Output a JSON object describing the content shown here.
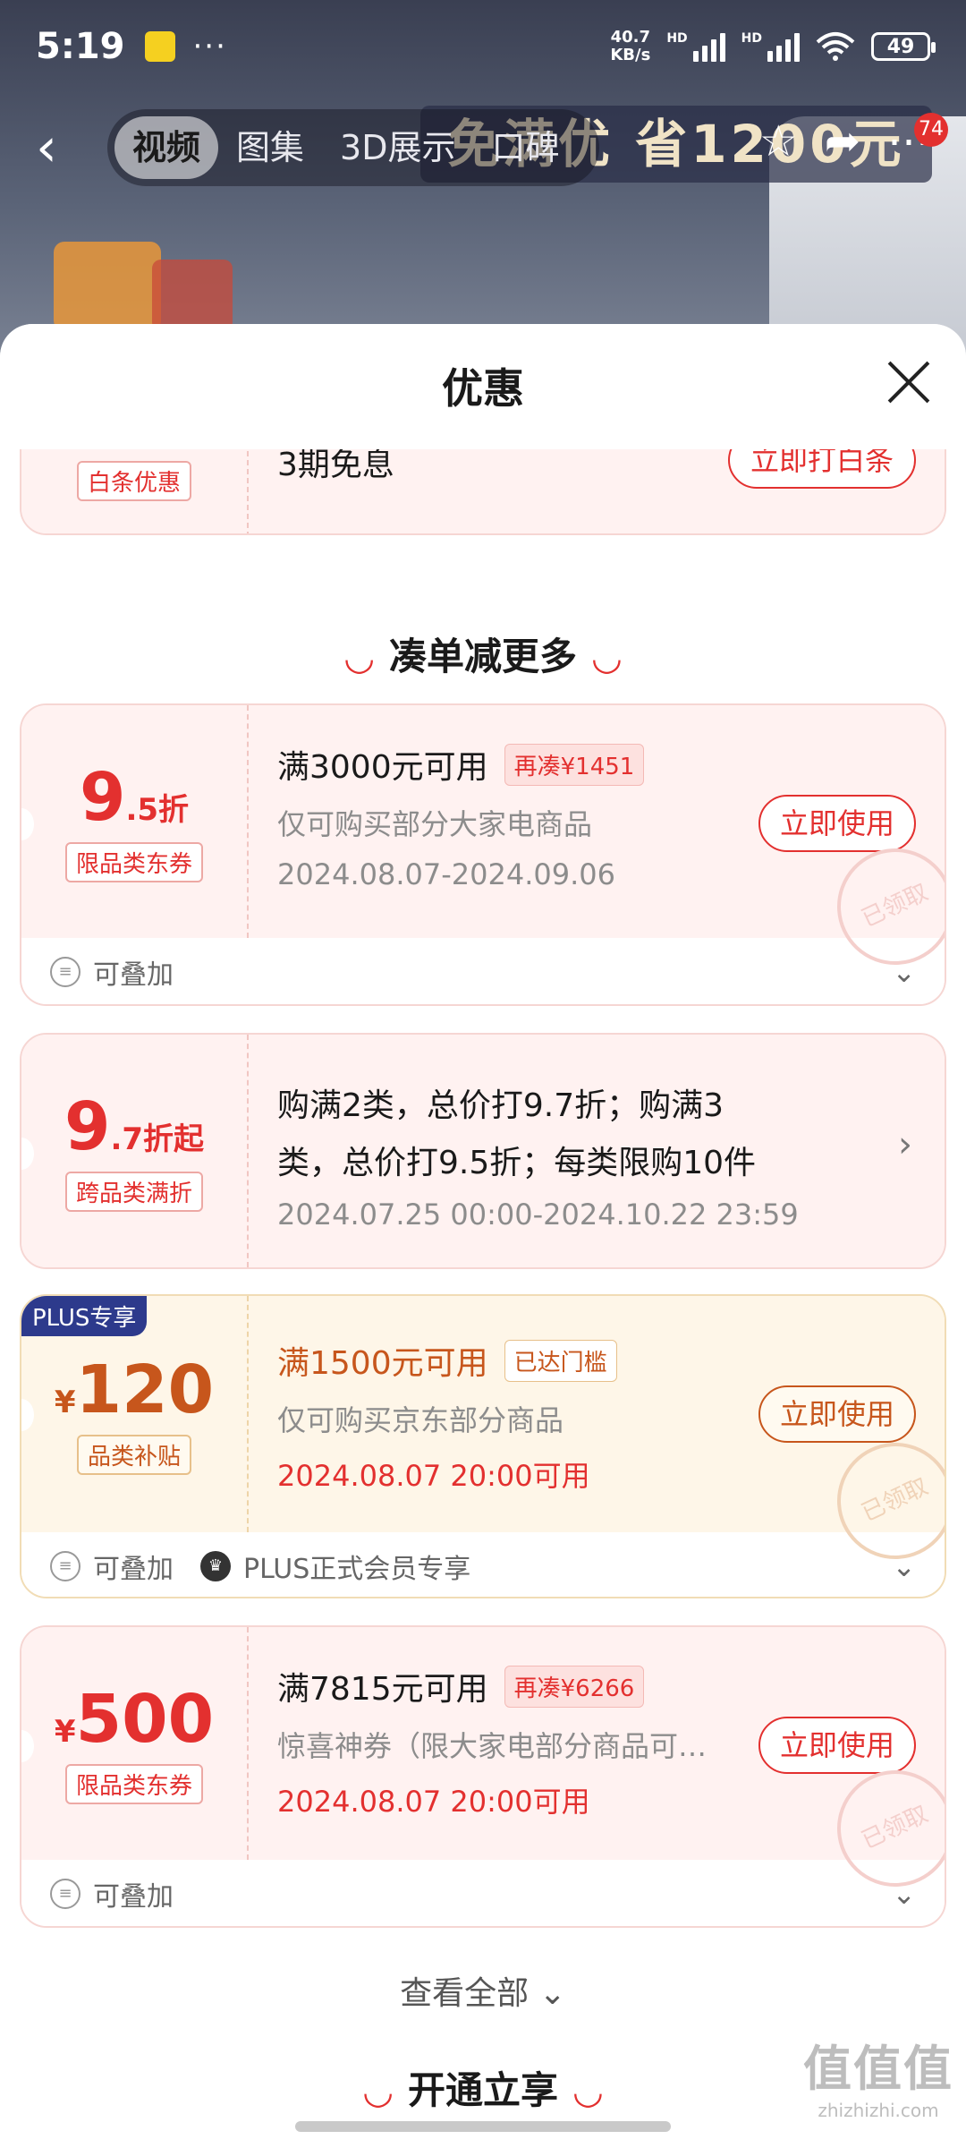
{
  "status_bar": {
    "time": "5:19",
    "dots": "···",
    "net_speed_value": "40.7",
    "net_speed_unit": "KB/s",
    "hd": "HD",
    "battery": "49"
  },
  "nav": {
    "tabs": [
      {
        "label": "视频",
        "active": true
      },
      {
        "label": "图集",
        "active": false
      },
      {
        "label": "3D展示",
        "active": false
      },
      {
        "label": "口碑",
        "active": false
      }
    ],
    "badge_count": "74",
    "banner_text": "免满优 省1200元"
  },
  "sheet": {
    "title": "优惠",
    "baitiao": {
      "tag": "白条优惠",
      "desc": "3期免息",
      "button": "立即打白条"
    },
    "section1": "凑单减更多",
    "coupons": [
      {
        "amount": "9",
        "amount_suffix": ".5折",
        "tag": "限品类东券",
        "condition": "满3000元可用",
        "mini_tag": "再凑¥1451",
        "scope": "仅可购买部分大家电商品",
        "date": "2024.08.07-2024.09.06",
        "button": "立即使用",
        "stamp": "已领取",
        "foot_stack": "可叠加"
      },
      {
        "amount": "9",
        "amount_suffix": ".7折起",
        "tag": "跨品类满折",
        "desc_line1": "购满2类，总价打9.7折；购满3",
        "desc_line2": "类，总价打9.5折；每类限购10件",
        "date": "2024.07.25 00:00-2024.10.22 23:59"
      },
      {
        "plus_badge": "PLUS专享",
        "currency": "¥",
        "amount": "120",
        "tag": "品类补贴",
        "condition": "满1500元可用",
        "mini_tag": "已达门槛",
        "scope": "仅可购买京东部分商品",
        "date": "2024.08.07 20:00可用",
        "button": "立即使用",
        "stamp": "已领取",
        "foot_stack": "可叠加",
        "foot_member": "PLUS正式会员专享"
      },
      {
        "currency": "¥",
        "amount": "500",
        "tag": "限品类东券",
        "condition": "满7815元可用",
        "mini_tag": "再凑¥6266",
        "scope": "惊喜神券（限大家电部分商品可…",
        "date": "2024.08.07 20:00可用",
        "button": "立即使用",
        "stamp": "已领取",
        "foot_stack": "可叠加"
      }
    ],
    "view_all": "查看全部",
    "section2": "开通立享"
  },
  "watermark": {
    "line1": "值值值",
    "line2": "zhizhizhi.com"
  },
  "colors": {
    "accent_red": "#e3302f",
    "gold": "#c7561c",
    "plus_blue": "#2d3a8c"
  }
}
